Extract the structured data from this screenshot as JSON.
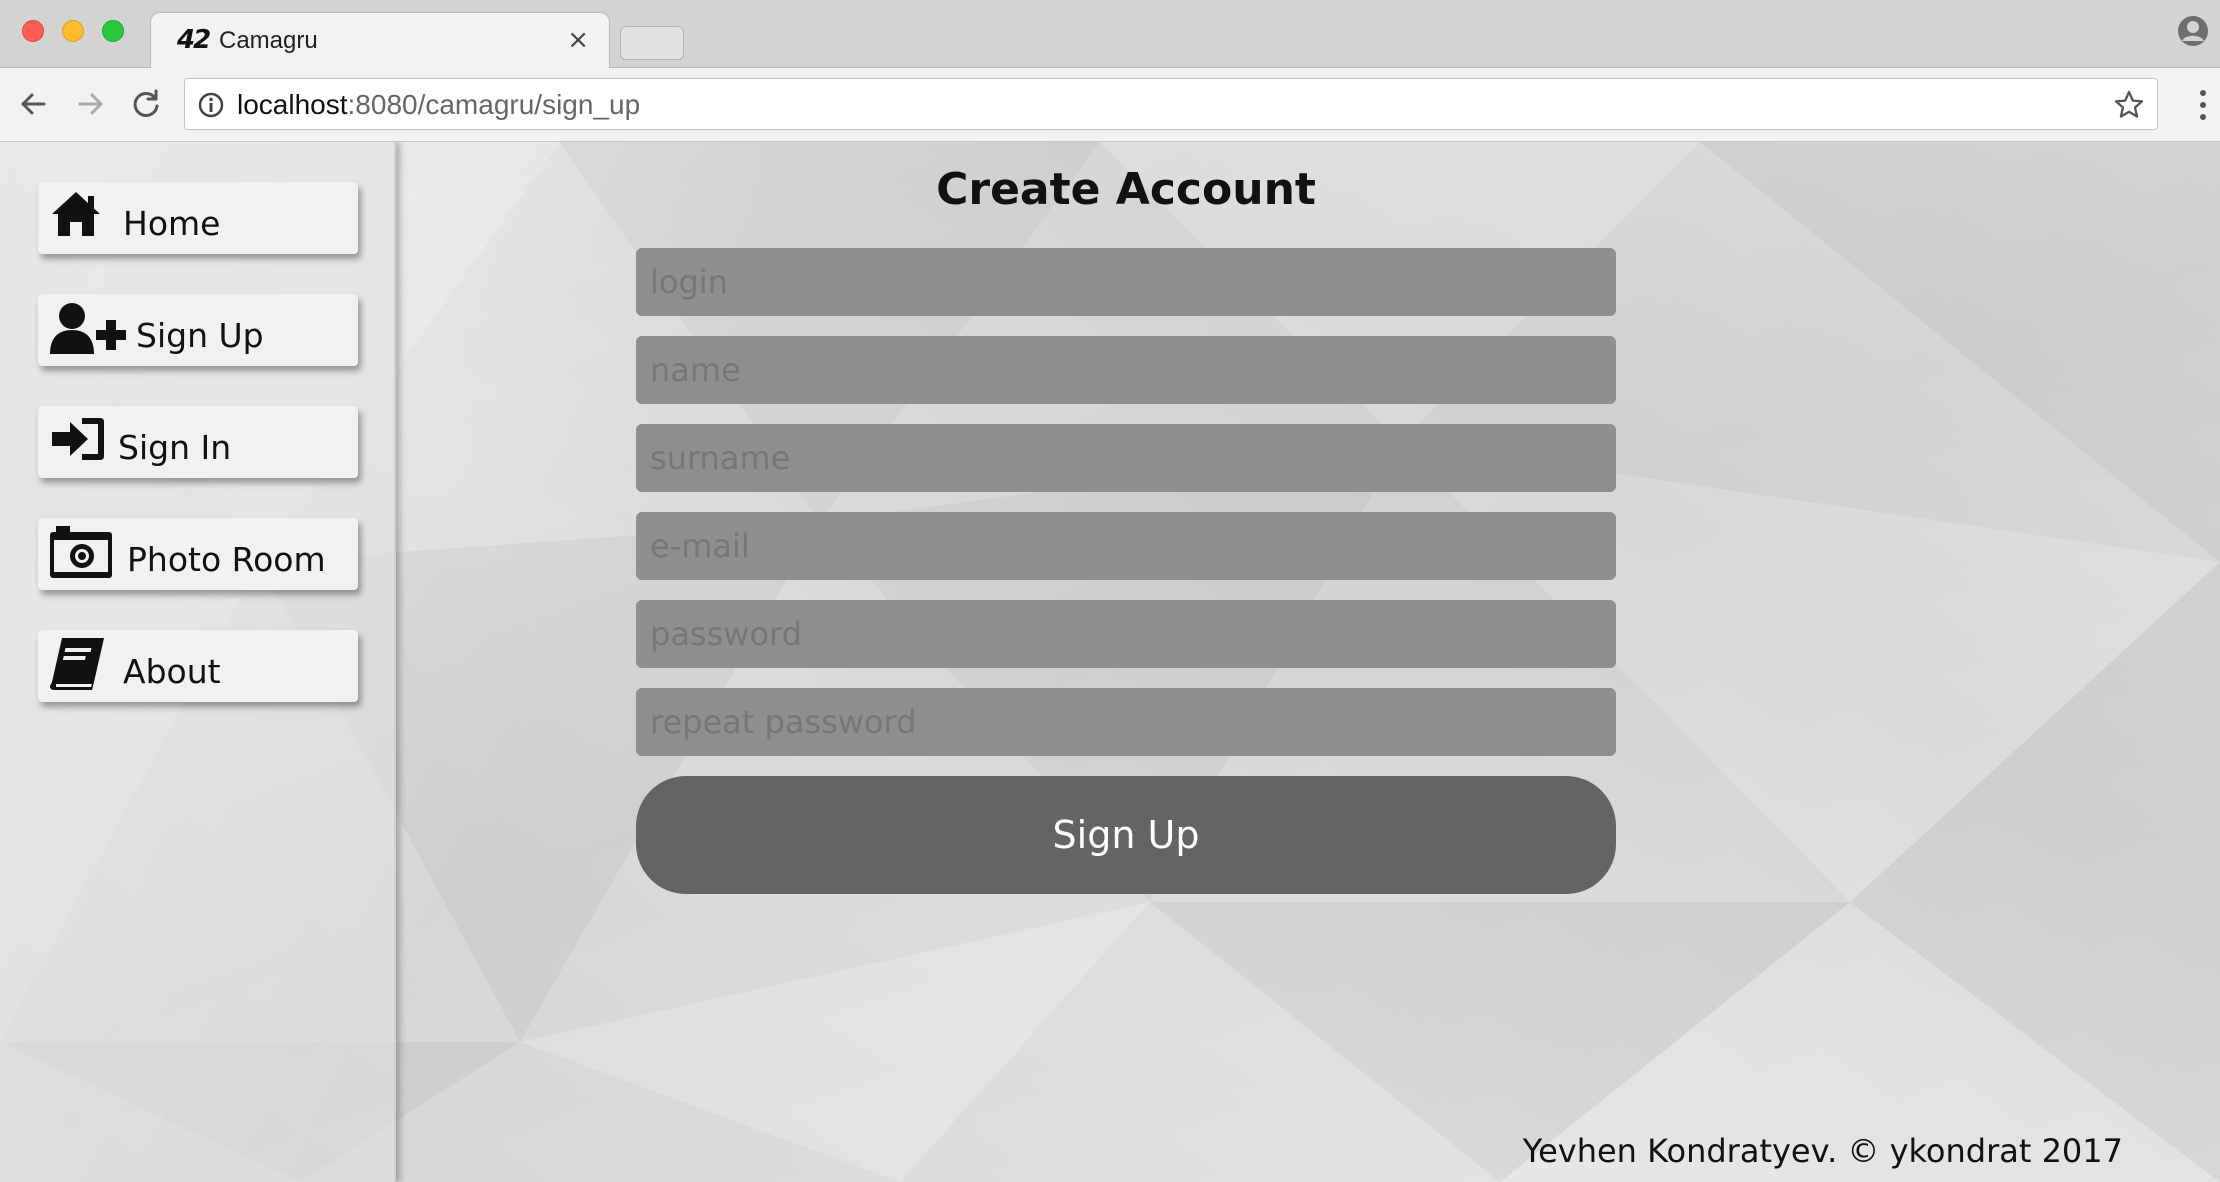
{
  "browser": {
    "tab_title": "Camagru",
    "tab_favicon": "42",
    "close_glyph": "×",
    "url_host": "localhost",
    "url_rest": ":8080/camagru/sign_up"
  },
  "sidebar": {
    "items": [
      {
        "label": "Home",
        "icon": "home-icon"
      },
      {
        "label": "Sign Up",
        "icon": "user-plus-icon"
      },
      {
        "label": "Sign In",
        "icon": "sign-in-icon"
      },
      {
        "label": "Photo Room",
        "icon": "camera-icon"
      },
      {
        "label": "About",
        "icon": "book-icon"
      }
    ]
  },
  "form": {
    "title": "Create Account",
    "fields": {
      "login": {
        "placeholder": "login",
        "value": ""
      },
      "name": {
        "placeholder": "name",
        "value": ""
      },
      "surname": {
        "placeholder": "surname",
        "value": ""
      },
      "email": {
        "placeholder": "e-mail",
        "value": ""
      },
      "password": {
        "placeholder": "password",
        "value": ""
      },
      "repeat_password": {
        "placeholder": "repeat password",
        "value": ""
      }
    },
    "submit_label": "Sign Up"
  },
  "footer": {
    "text": "Yevhen Kondratyev. © ykondrat 2017"
  },
  "colors": {
    "field_bg": "#8f8f8f",
    "button_bg": "#646464",
    "page_bg": "#e6e6e6"
  }
}
